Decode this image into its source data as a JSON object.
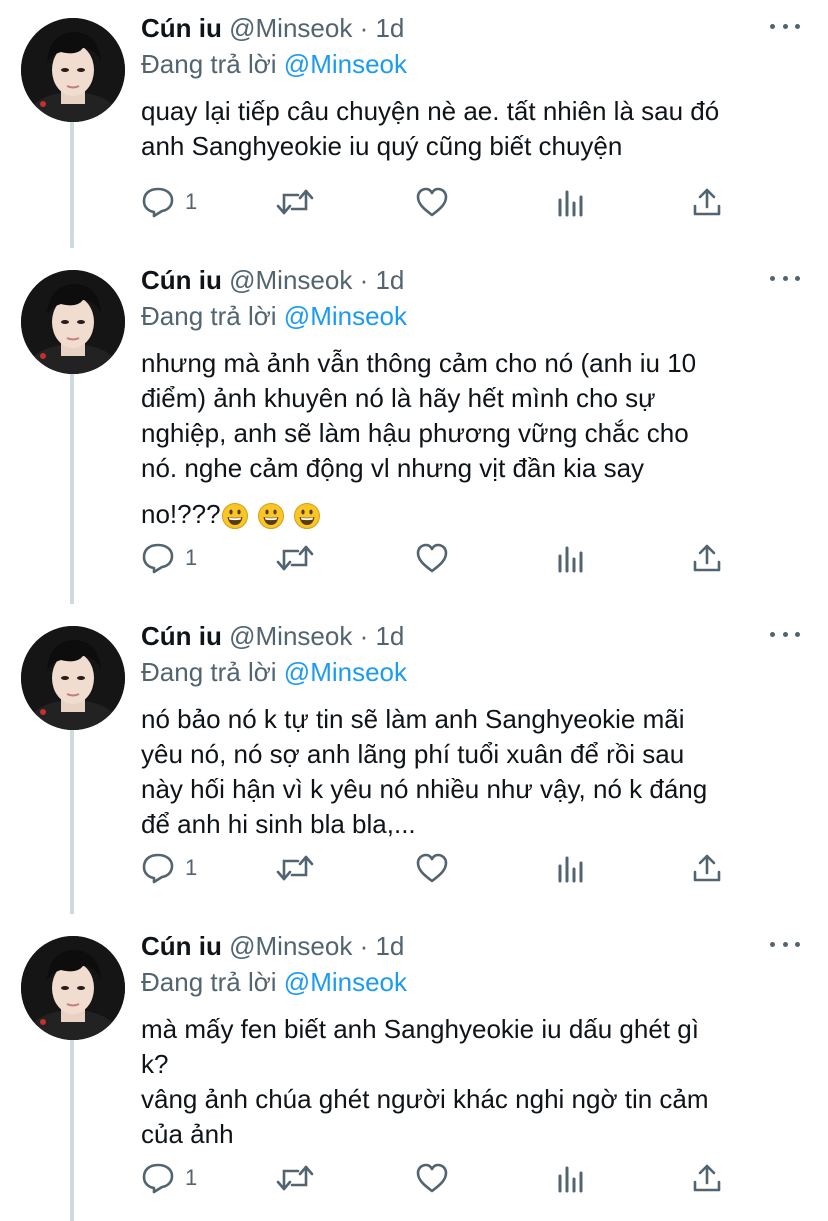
{
  "colors": {
    "accent": "#1d9bf0",
    "secondary_text": "#536471",
    "primary_text": "#0f1419",
    "thread_line": "#cfd9de"
  },
  "tweets": [
    {
      "name": "Cún iu",
      "handle": "@Minseok",
      "dot": "·",
      "time": "1d",
      "replying_prefix": "Đang trả lời",
      "replying_to": "@Minseok",
      "text": "quay lại tiếp câu chuyện nè ae. tất nhiên là sau đó\nanh Sanghyeokie iu quý cũng biết chuyện",
      "emoji_line": "",
      "reply_count": "1"
    },
    {
      "name": "Cún iu",
      "handle": "@Minseok",
      "dot": "·",
      "time": "1d",
      "replying_prefix": "Đang trả lời",
      "replying_to": "@Minseok",
      "text": "nhưng mà ảnh vẫn thông cảm cho nó (anh iu 10\nđiểm) ảnh khuyên nó là hãy hết mình cho sự\nnghiệp, anh sẽ làm hậu phương vững chắc cho\nnó. nghe cảm động vl nhưng vịt đần kia say",
      "emoji_line": "no!???",
      "reply_count": "1"
    },
    {
      "name": "Cún iu",
      "handle": "@Minseok",
      "dot": "·",
      "time": "1d",
      "replying_prefix": "Đang trả lời",
      "replying_to": "@Minseok",
      "text": "nó bảo nó k tự tin sẽ làm anh Sanghyeokie mãi\nyêu nó, nó sợ anh lãng phí tuổi xuân để rồi sau\nnày hối hận vì k yêu nó nhiều như vậy, nó k đáng\nđể anh hi sinh bla bla,...",
      "emoji_line": "",
      "reply_count": "1"
    },
    {
      "name": "Cún iu",
      "handle": "@Minseok",
      "dot": "·",
      "time": "1d",
      "replying_prefix": "Đang trả lời",
      "replying_to": "@Minseok",
      "text": "mà mấy fen biết anh Sanghyeokie iu dấu ghét gì\nk?\nvâng ảnh chúa ghét người khác nghi ngờ tin cảm\ncủa ảnh",
      "emoji_line": "",
      "reply_count": "1"
    }
  ],
  "icons": {
    "reply": "reply-icon",
    "retweet": "retweet-icon",
    "like": "heart-icon",
    "analytics": "analytics-icon",
    "share": "share-icon",
    "more": "more-icon",
    "emoji": "grinning-face-emoji"
  }
}
